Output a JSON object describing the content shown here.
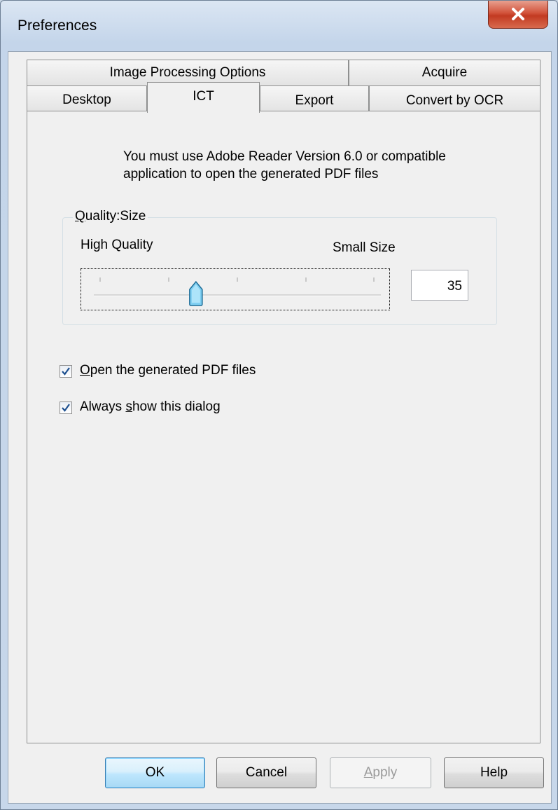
{
  "window": {
    "title": "Preferences"
  },
  "tabs": {
    "row1": [
      {
        "label": "Image Processing Options"
      },
      {
        "label": "Acquire"
      }
    ],
    "row2": [
      {
        "label": "Desktop"
      },
      {
        "label": "ICT",
        "active": true
      },
      {
        "label": "Export"
      },
      {
        "label": "Convert by OCR"
      }
    ]
  },
  "ict": {
    "info_line1": "You must use Adobe Reader Version 6.0 or compatible",
    "info_line2": "application to open the generated PDF files",
    "group_label_accel": "Q",
    "group_label_rest": "uality:Size",
    "high_quality": "High Quality",
    "small_size": "Small Size",
    "slider_value": 35,
    "slider_value_text": "35",
    "slider_min": 0,
    "slider_max": 100,
    "open_pdf": {
      "checked": true,
      "accel": "O",
      "rest": "pen the generated PDF files"
    },
    "always_show": {
      "checked": true,
      "pre": "Always ",
      "accel": "s",
      "rest": "how this dialog"
    }
  },
  "buttons": {
    "ok": "OK",
    "cancel": "Cancel",
    "apply_accel": "A",
    "apply_rest": "pply",
    "help": "Help"
  },
  "colors": {
    "close_button": "#c23a22",
    "default_button": "#3c7fb1",
    "slider_thumb": "#3fa8d8"
  }
}
